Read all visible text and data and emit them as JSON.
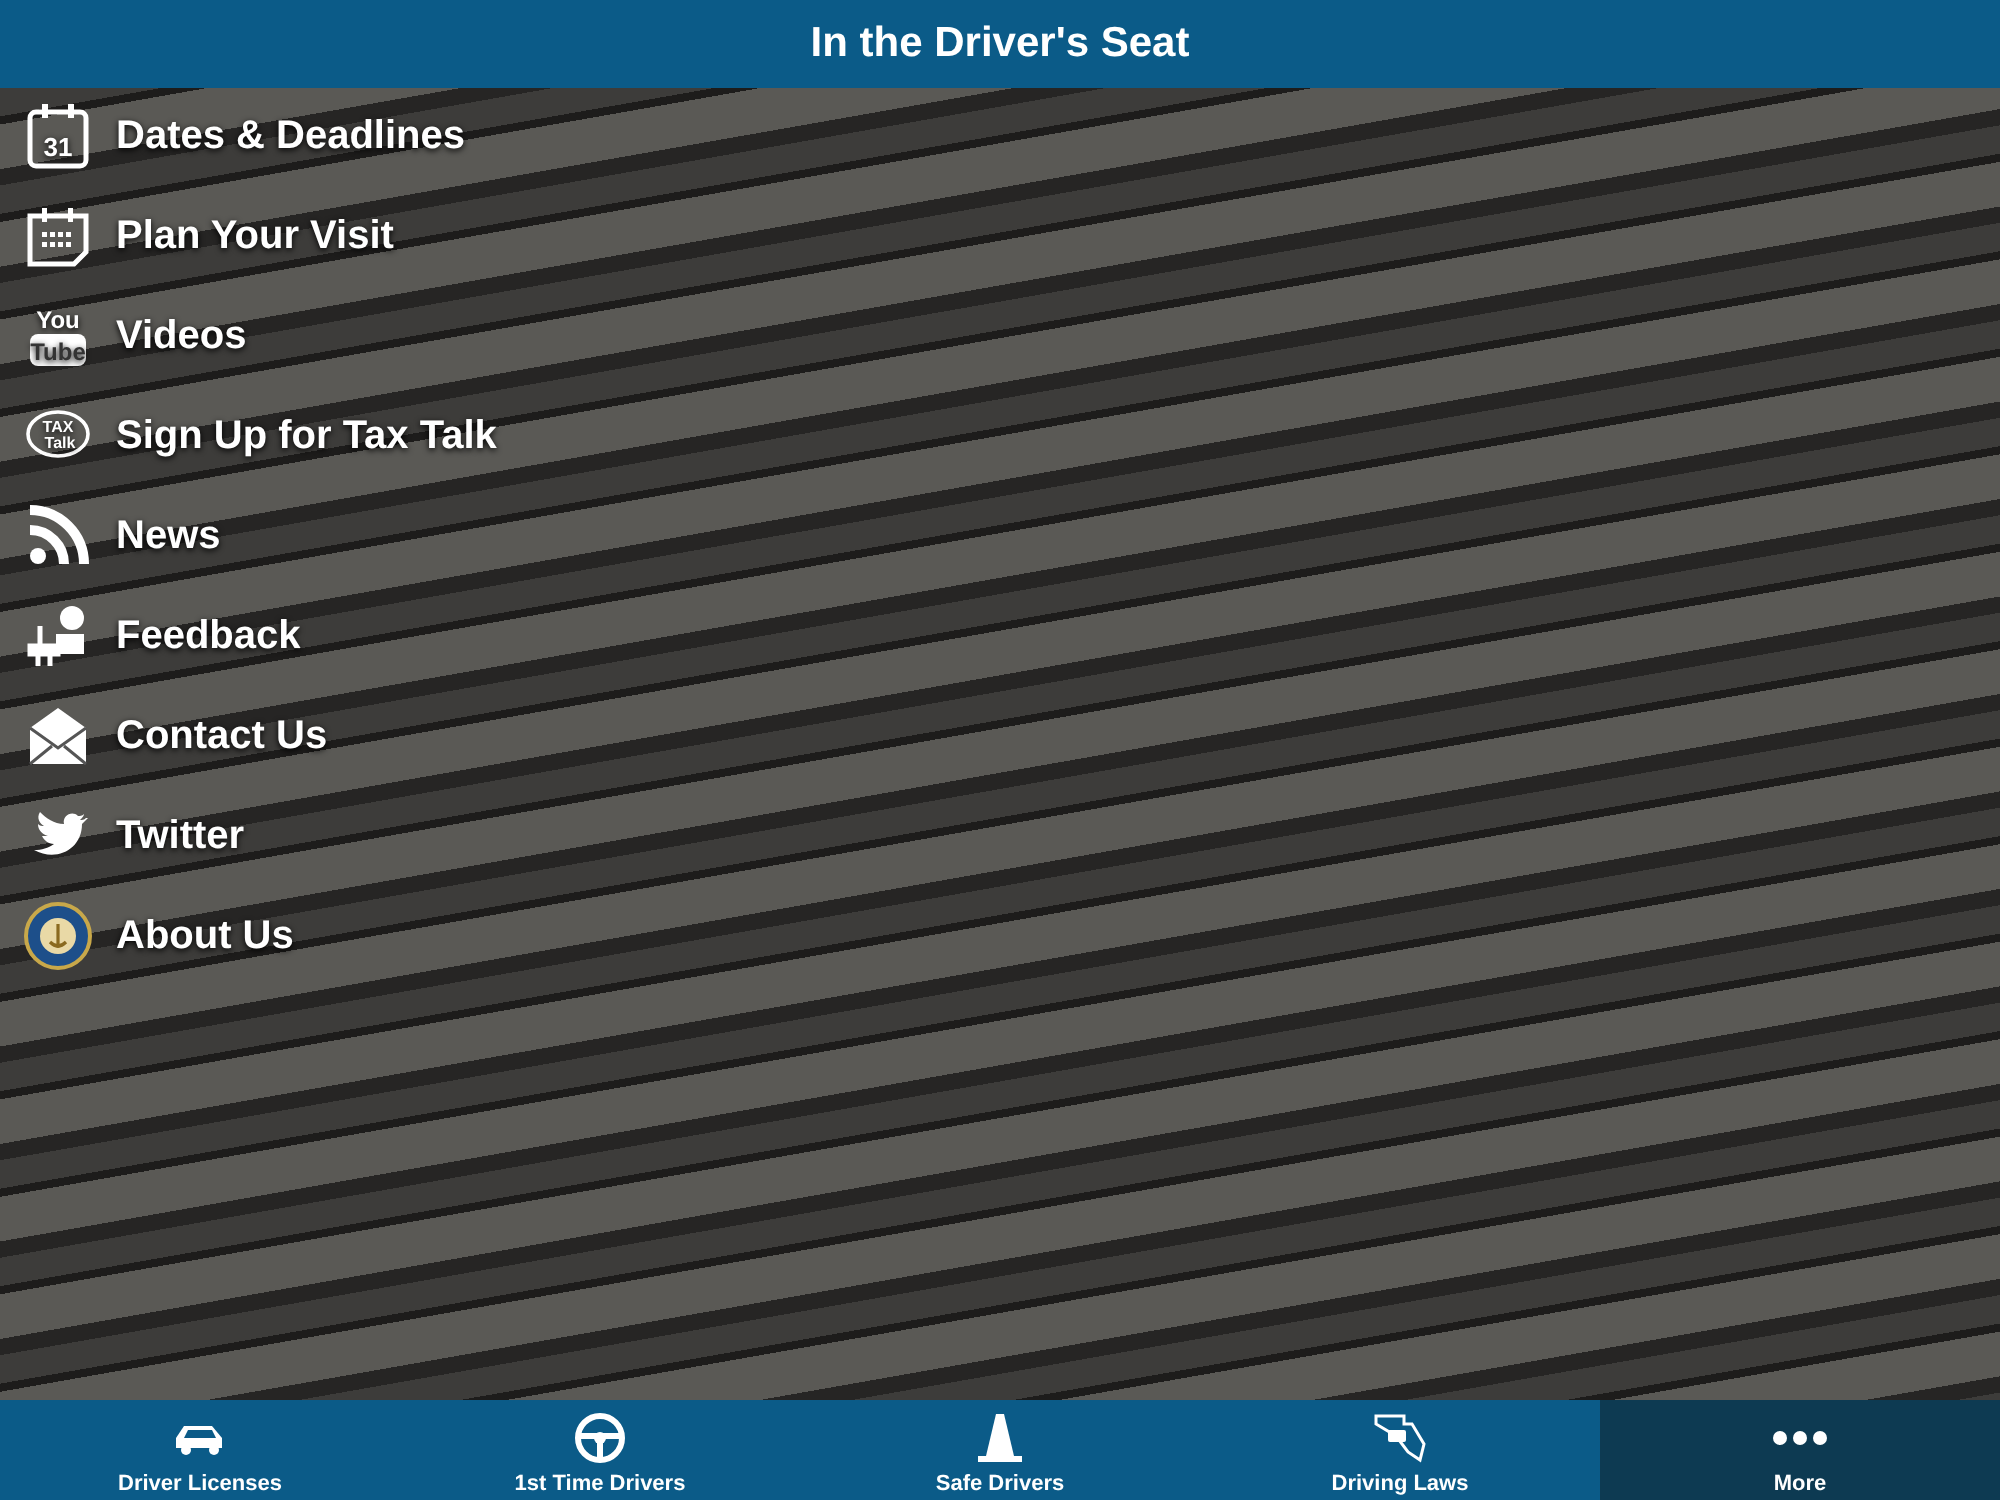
{
  "header": {
    "title": "In the Driver's Seat"
  },
  "menu": [
    {
      "label": "Dates & Deadlines",
      "kind": "calendar",
      "icon_text": [
        "31"
      ]
    },
    {
      "label": "Plan Your Visit",
      "kind": "planner"
    },
    {
      "label": "Videos",
      "kind": "youtube",
      "icon_text": [
        "You",
        "Tube"
      ]
    },
    {
      "label": "Sign Up for Tax Talk",
      "kind": "taxtalk",
      "icon_text": [
        "TAX",
        "Talk"
      ]
    },
    {
      "label": "News",
      "kind": "rss"
    },
    {
      "label": "Feedback",
      "kind": "feedback"
    },
    {
      "label": "Contact Us",
      "kind": "mail"
    },
    {
      "label": "Twitter",
      "kind": "bird"
    },
    {
      "label": "About Us",
      "kind": "seal"
    }
  ],
  "tabs": [
    {
      "label": "Driver Licenses",
      "kind": "car",
      "selected": false
    },
    {
      "label": "1st Time Drivers",
      "kind": "wheel",
      "selected": false
    },
    {
      "label": "Safe Drivers",
      "kind": "cone",
      "selected": false
    },
    {
      "label": "Driving Laws",
      "kind": "map",
      "selected": false
    },
    {
      "label": "More",
      "kind": "dots",
      "selected": true
    }
  ]
}
